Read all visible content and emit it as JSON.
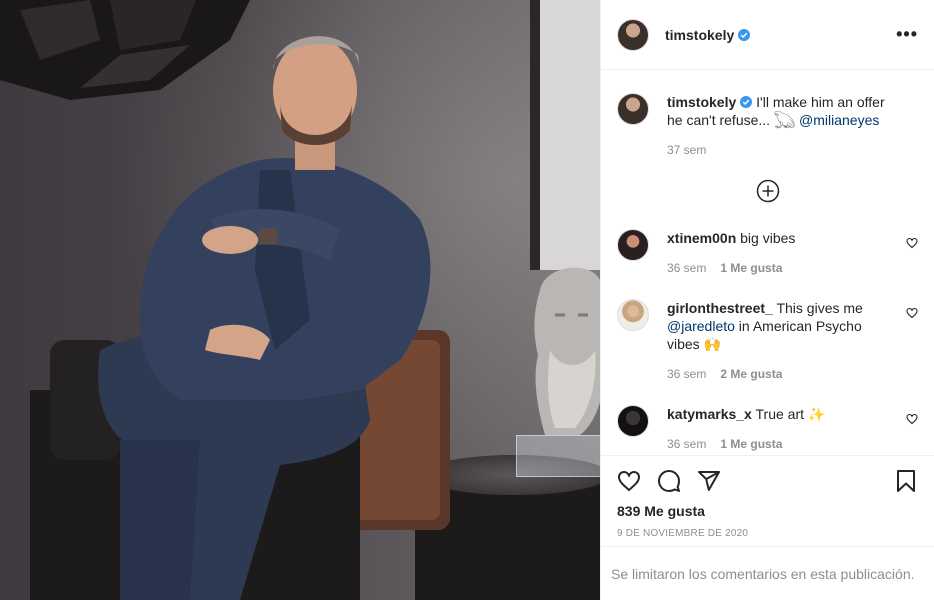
{
  "post": {
    "username": "timstokely",
    "more_label": "•••",
    "caption": {
      "text": "I'll make him an offer he can't refuse... 𓆏 ",
      "mention": "@milianeyes",
      "time": "37 sem"
    },
    "comments": [
      {
        "username": "xtinem00n",
        "text": "big vibes",
        "time": "36 sem",
        "likes": "1 Me gusta"
      },
      {
        "username": "girlonthestreet_",
        "text": "This gives me ",
        "mention": "@jaredleto",
        "text_after": " in American Psycho vibes 🙌",
        "time": "36 sem",
        "likes": "2 Me gusta"
      },
      {
        "username": "katymarks_x",
        "text": "True art ✨",
        "time": "36 sem",
        "likes": "1 Me gusta"
      }
    ],
    "likes_count": "839 Me gusta",
    "date": "9 DE NOVIEMBRE DE 2020",
    "comments_limited": "Se limitaron los comentarios en esta publicación."
  },
  "colors": {
    "verified": "#3897f0",
    "mention": "#00376b",
    "muted": "#8e8e8e",
    "text": "#262626"
  },
  "icons": [
    "verified-icon",
    "more-icon",
    "load-more-icon",
    "heart-icon",
    "comment-icon",
    "share-icon",
    "bookmark-icon"
  ]
}
